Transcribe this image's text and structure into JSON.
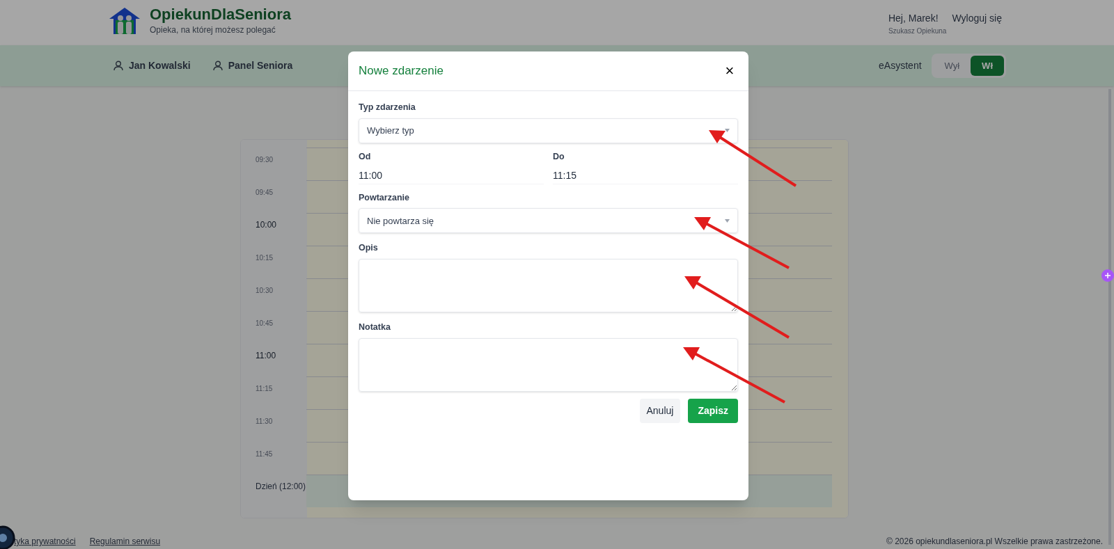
{
  "header": {
    "logo_title": "OpiekunDlaSeniora",
    "tagline": "Opieka, na której możesz polegać",
    "greeting": "Hej, Marek!",
    "role": "Szukasz Opiekuna",
    "logout": "Wyloguj się"
  },
  "nav": {
    "items": [
      "Jan Kowalski",
      "Panel Seniora"
    ],
    "assistant_label": "eAsystent",
    "assistant_toggle": [
      {
        "label": "Wył",
        "selected": false
      },
      {
        "label": "Wł",
        "selected": true
      }
    ]
  },
  "calendar": {
    "rows": [
      {
        "time": "09:30",
        "kind": "quarter"
      },
      {
        "time": "09:45",
        "kind": "quarter"
      },
      {
        "time": "10:00",
        "kind": "hour"
      },
      {
        "time": "10:15",
        "kind": "quarter"
      },
      {
        "time": "10:30",
        "kind": "quarter"
      },
      {
        "time": "10:45",
        "kind": "quarter"
      },
      {
        "time": "11:00",
        "kind": "hour"
      },
      {
        "time": "11:15",
        "kind": "quarter"
      },
      {
        "time": "11:30",
        "kind": "quarter"
      },
      {
        "time": "11:45",
        "kind": "quarter"
      },
      {
        "time": "Dzień (12:00)",
        "kind": "period"
      }
    ]
  },
  "modal": {
    "title": "Nowe zdarzenie",
    "close": "×",
    "fields": [
      {
        "kind": "select",
        "label": "Typ zdarzenia",
        "value": "Wybierz typ"
      },
      {
        "kind": "pair",
        "items": [
          {
            "label": "Od",
            "value": "11:00"
          },
          {
            "label": "Do",
            "value": "11:15"
          }
        ]
      },
      {
        "kind": "select",
        "label": "Powtarzanie",
        "value": "Nie powtarza się"
      },
      {
        "kind": "textarea",
        "label": "Opis"
      },
      {
        "kind": "textarea",
        "label": "Notatka"
      }
    ],
    "buttons": [
      {
        "label": "Anuluj",
        "kind": "secondary"
      },
      {
        "label": "Zapisz",
        "kind": "primary"
      }
    ]
  },
  "footer": {
    "links": [
      "tyka prywatności",
      "Regulamin serwisu"
    ],
    "copyright": "© 2026 opiekundlaseniora.pl Wszelkie prawa zastrzeżone."
  }
}
